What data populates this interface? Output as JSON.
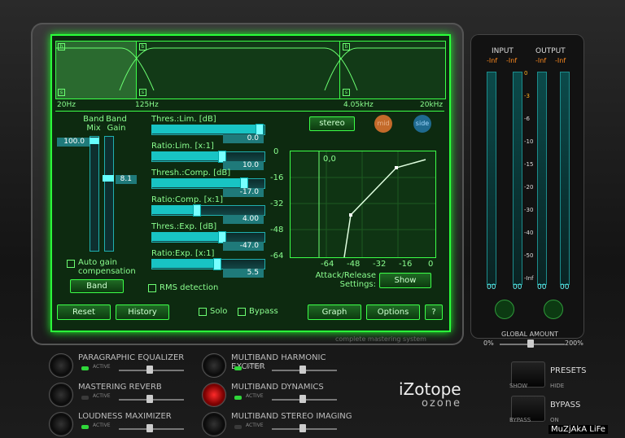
{
  "band_graph": {
    "freqs": [
      "20Hz",
      "125Hz",
      "4.05kHz",
      "20kHz"
    ],
    "band_marker": "b",
    "solo_marker": "s"
  },
  "controls": {
    "band_mix": {
      "label": "Band\nMix",
      "value": "100.0"
    },
    "band_gain": {
      "label": "Band\nGain",
      "value": "8.1"
    },
    "sliders": [
      {
        "label": "Thres.:Lim. [dB]",
        "value": "0.0",
        "fill": 0.96
      },
      {
        "label": "Ratio:Lim. [x:1]",
        "value": "10.0",
        "fill": 0.62
      },
      {
        "label": "Thresh.:Comp. [dB]",
        "value": "-17.0",
        "fill": 0.82
      },
      {
        "label": "Ratio:Comp. [x:1]",
        "value": "4.00",
        "fill": 0.4
      },
      {
        "label": "Thres.:Exp. [dB]",
        "value": "-47.0",
        "fill": 0.62
      },
      {
        "label": "Ratio:Exp. [x:1]",
        "value": "5.5",
        "fill": 0.58
      }
    ],
    "auto_gain": "Auto gain compensation",
    "band_button": "Band",
    "rms": "RMS detection",
    "stereo": "stereo",
    "mid": "mid",
    "side": "side",
    "graph_value": "0,0",
    "graph_ticks_y": [
      "0",
      "-16",
      "-32",
      "-48",
      "-64"
    ],
    "graph_ticks_x": [
      "-64",
      "-48",
      "-32",
      "-16",
      "0"
    ],
    "attack_release": "Attack/Release Settings:",
    "show": "Show"
  },
  "bottom_bar": {
    "reset": "Reset",
    "history": "History",
    "solo": "Solo",
    "bypass": "Bypass",
    "graph": "Graph",
    "options": "Options",
    "help": "?"
  },
  "tagline": "complete mastering system",
  "meters": {
    "input": "INPUT",
    "output": "OUTPUT",
    "inf": "-Inf",
    "zero": "00",
    "scale": [
      "0",
      "-3",
      "-6",
      "-10",
      "-15",
      "-20",
      "-30",
      "-40",
      "-50",
      "-Inf"
    ]
  },
  "global": {
    "label": "GLOBAL AMOUNT",
    "min": "0%",
    "max": "200%"
  },
  "modules": [
    {
      "name": "PARAGRAPHIC EQUALIZER",
      "active": "ACTIVE",
      "on": true
    },
    {
      "name": "MASTERING REVERB",
      "active": "ACTIVE",
      "on": false
    },
    {
      "name": "LOUDNESS MAXIMIZER",
      "active": "ACTIVE",
      "on": true
    },
    {
      "name": "MULTIBAND HARMONIC EXCITER",
      "active": "ACTIVE",
      "on": true
    },
    {
      "name": "MULTIBAND DYNAMICS",
      "active": "ACTIVE",
      "on": true
    },
    {
      "name": "MULTIBAND STEREO IMAGING",
      "active": "ACTIVE",
      "on": false
    }
  ],
  "logo": {
    "brand": "iZotope",
    "product": "ozone"
  },
  "side_controls": {
    "presets": "PRESETS",
    "show": "SHOW",
    "hide": "HIDE",
    "bypass": "BYPASS",
    "bypass_small": "BYPASS",
    "on": "ON"
  },
  "watermark": "MuZjAkA LiFe"
}
